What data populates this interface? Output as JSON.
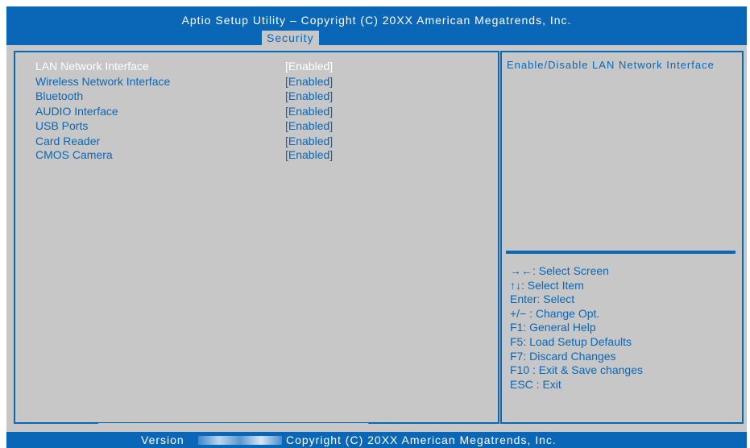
{
  "header": {
    "title": "Aptio Setup Utility – Copyright  (C) 20XX American Megatrends,  Inc.",
    "active_tab": "Security"
  },
  "settings": [
    {
      "label": "LAN Network Interface",
      "value": "[Enabled]",
      "selected": true
    },
    {
      "label": "Wireless Network Interface",
      "value": "[Enabled]",
      "selected": false
    },
    {
      "label": "Bluetooth",
      "value": "[Enabled]",
      "selected": false
    },
    {
      "label": "AUDIO Interface",
      "value": "[Enabled]",
      "selected": false
    },
    {
      "label": "USB Ports",
      "value": "[Enabled]",
      "selected": false
    },
    {
      "label": "Card Reader",
      "value": "[Enabled]",
      "selected": false
    },
    {
      "label": "CMOS Camera",
      "value": "[Enabled]",
      "selected": false
    }
  ],
  "help": {
    "description": "Enable/Disable LAN Network Interface"
  },
  "keys": [
    "→←:  Select Screen",
    "↑↓:  Select Item",
    "Enter:  Select",
    "+/− :  Change Opt.",
    "F1:  General  Help",
    "F5:  Load Setup Defaults",
    "F7:  Discard Changes",
    "F10 :  Exit & Save changes",
    "ESC :  Exit"
  ],
  "footer": {
    "version_label": "Version",
    "copyright": "Copyright  (C)  20XX American Megatrends,  Inc."
  },
  "colors": {
    "accent": "#0a67b8",
    "background": "#c7c7c7",
    "selected_text": "#ffffff"
  }
}
